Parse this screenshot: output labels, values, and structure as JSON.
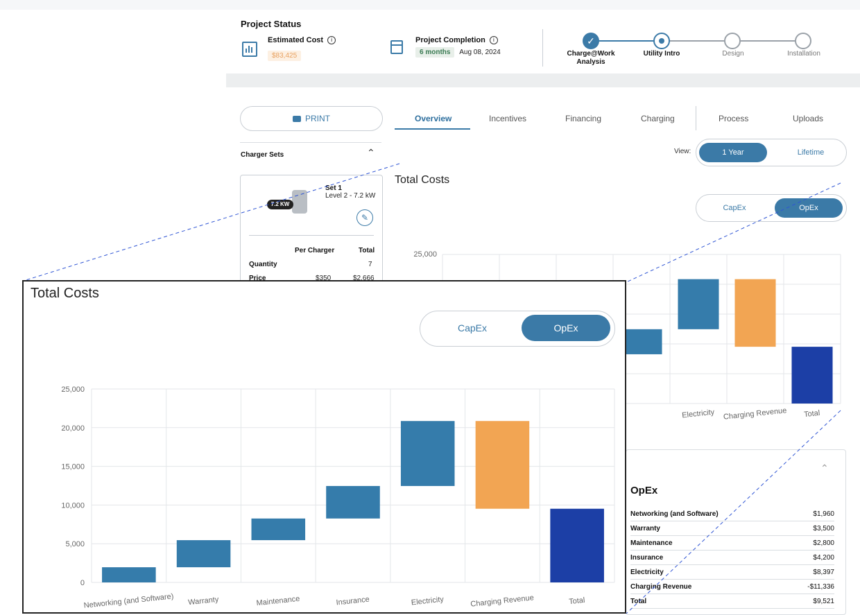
{
  "status": {
    "title": "Project Status",
    "estimated_cost_label": "Estimated Cost",
    "estimated_cost_value": "$83,425",
    "completion_label": "Project Completion",
    "completion_duration": "6 months",
    "completion_date": "Aug 08, 2024",
    "steps": [
      {
        "label": "Charge@Work\nAnalysis",
        "state": "done"
      },
      {
        "label": "Utility Intro",
        "state": "current"
      },
      {
        "label": "Design",
        "state": "todo"
      },
      {
        "label": "Installation",
        "state": "todo"
      }
    ]
  },
  "sidebar": {
    "print_label": "PRINT",
    "charger_sets_label": "Charger Sets",
    "set_title": "Set 1",
    "set_subtitle": "Level 2 - 7.2 kW",
    "kw_badge": "7.2 KW",
    "table_headers": [
      "Per Charger",
      "Total"
    ],
    "rows": [
      {
        "label": "Quantity",
        "per": "",
        "total": "7"
      },
      {
        "label": "Price",
        "per": "$350",
        "total": "$2,666"
      }
    ]
  },
  "tabs": [
    "Overview",
    "Incentives",
    "Financing",
    "Charging",
    "Process",
    "Uploads"
  ],
  "active_tab": "Overview",
  "view": {
    "label": "View:",
    "options": [
      "1 Year",
      "Lifetime"
    ],
    "selected": "1 Year"
  },
  "section_title": "Total Costs",
  "costtype": {
    "options": [
      "CapEx",
      "OpEx"
    ],
    "selected": "OpEx"
  },
  "opex_table": {
    "title": "OpEx",
    "rows": [
      {
        "label": "Networking (and Software)",
        "value": "$1,960"
      },
      {
        "label": "Warranty",
        "value": "$3,500"
      },
      {
        "label": "Maintenance",
        "value": "$2,800"
      },
      {
        "label": "Insurance",
        "value": "$4,200"
      },
      {
        "label": "Electricity",
        "value": "$8,397"
      },
      {
        "label": "Charging Revenue",
        "value": "-$11,336"
      },
      {
        "label": "Total",
        "value": "$9,521"
      }
    ]
  },
  "colors": {
    "accent": "#3b7aa7",
    "bar_blue": "#357cab",
    "bar_orange": "#f2a553",
    "bar_total": "#1c3fa6"
  },
  "chart_data": {
    "type": "bar",
    "subtype": "waterfall",
    "title": "Total Costs",
    "categories": [
      "Networking (and Software)",
      "Warranty",
      "Maintenance",
      "Insurance",
      "Electricity",
      "Charging Revenue",
      "Total"
    ],
    "values": [
      1960,
      3500,
      2800,
      4200,
      8397,
      -11336,
      9521
    ],
    "ylim": [
      0,
      25000
    ],
    "yticks": [
      "0",
      "5,000",
      "10,000",
      "15,000",
      "20,000",
      "25,000"
    ],
    "grid": true,
    "legend": "none"
  }
}
